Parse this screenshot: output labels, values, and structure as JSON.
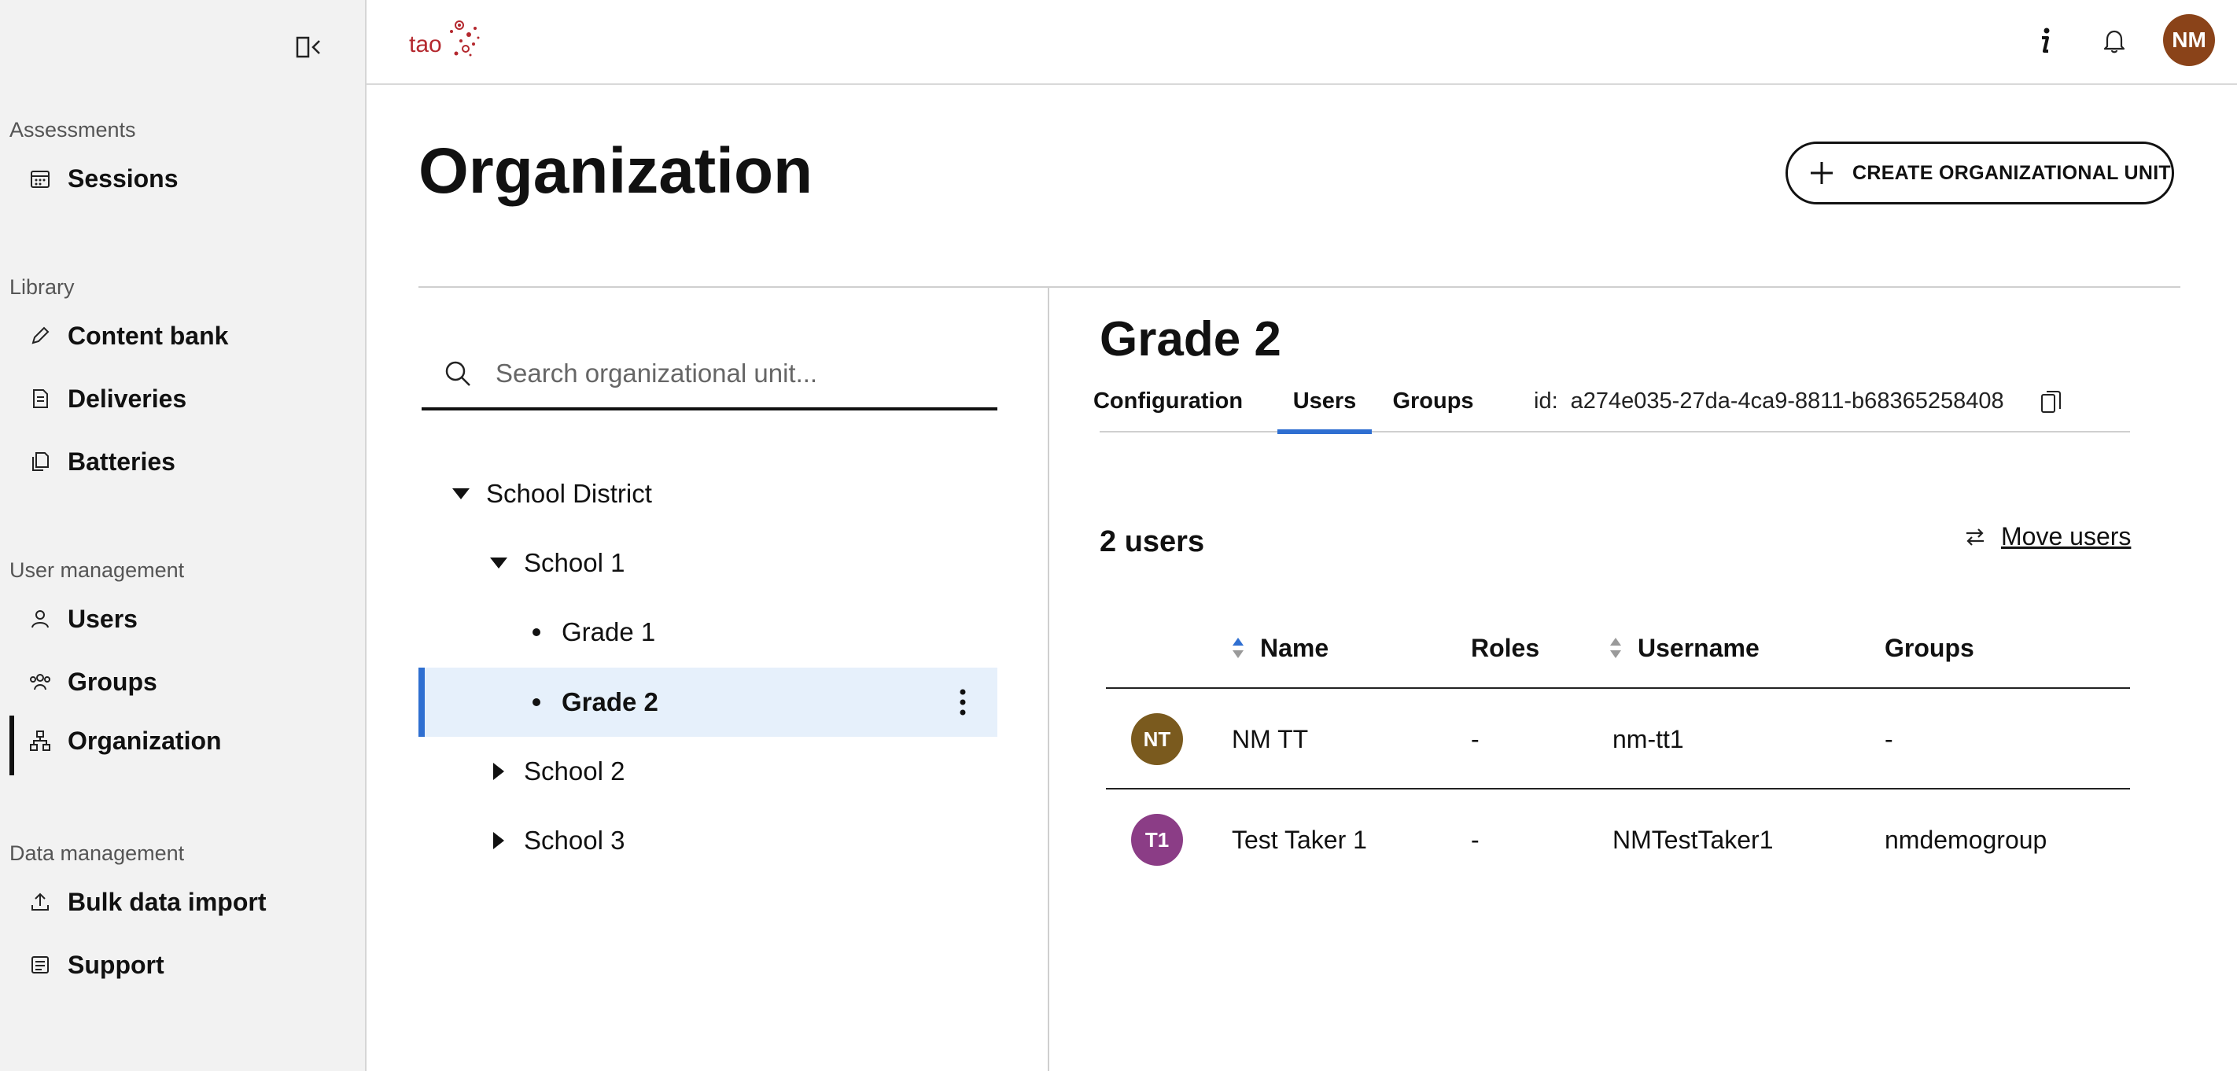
{
  "app": {
    "logo_text": "tao"
  },
  "sidebar": {
    "sections": [
      {
        "label": "Assessments"
      },
      {
        "label": "Library"
      },
      {
        "label": "User management"
      },
      {
        "label": "Data management"
      }
    ],
    "items": [
      {
        "label": "Sessions",
        "icon": "calendar-icon"
      },
      {
        "label": "Content bank",
        "icon": "pencil-icon"
      },
      {
        "label": "Deliveries",
        "icon": "document-icon"
      },
      {
        "label": "Batteries",
        "icon": "files-icon"
      },
      {
        "label": "Users",
        "icon": "user-icon"
      },
      {
        "label": "Groups",
        "icon": "group-icon"
      },
      {
        "label": "Organization",
        "icon": "hierarchy-icon",
        "active": true
      },
      {
        "label": "Bulk data import",
        "icon": "upload-icon"
      },
      {
        "label": "Support",
        "icon": "support-icon"
      }
    ]
  },
  "header": {
    "info_icon": "info-icon",
    "bell_icon": "bell-icon",
    "avatar_initials": "NM",
    "avatar_color": "#8a4319"
  },
  "page": {
    "title": "Organization",
    "create_button_label": "CREATE ORGANIZATIONAL UNIT"
  },
  "tree": {
    "search_placeholder": "Search organizational unit...",
    "nodes": [
      {
        "label": "School District",
        "state": "expanded",
        "level": 0
      },
      {
        "label": "School 1",
        "state": "expanded",
        "level": 1
      },
      {
        "label": "Grade 1",
        "state": "leaf",
        "level": 2
      },
      {
        "label": "Grade 2",
        "state": "leaf",
        "level": 2,
        "selected": true
      },
      {
        "label": "School 2",
        "state": "collapsed",
        "level": 1
      },
      {
        "label": "School 3",
        "state": "collapsed",
        "level": 1
      }
    ]
  },
  "detail": {
    "title": "Grade 2",
    "tabs": [
      {
        "label": "Configuration"
      },
      {
        "label": "Users",
        "active": true
      },
      {
        "label": "Groups"
      }
    ],
    "id_label": "id:",
    "id_value": "a274e035-27da-4ca9-8811-b68365258408",
    "user_count": "2 users",
    "move_users_label": "Move users",
    "accent_color": "#2f6fd1",
    "table": {
      "columns": [
        "Name",
        "Roles",
        "Username",
        "Groups"
      ],
      "rows": [
        {
          "initials": "NT",
          "avatar_color": "#7a5a1e",
          "name": "NM TT",
          "roles": "-",
          "username": "nm-tt1",
          "groups": "-"
        },
        {
          "initials": "T1",
          "avatar_color": "#8b3d86",
          "name": "Test Taker 1",
          "roles": "-",
          "username": "NMTestTaker1",
          "groups": "nmdemogroup"
        }
      ]
    }
  }
}
